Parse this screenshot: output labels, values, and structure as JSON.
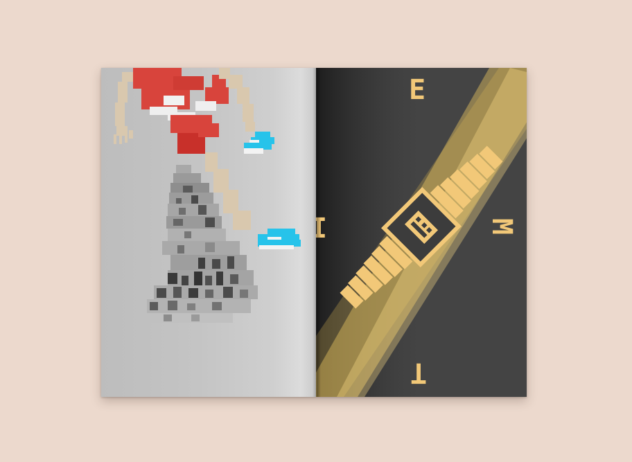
{
  "spread": {
    "left_page": {
      "illustration": "pixel-art-runner-over-rocks"
    },
    "right_page": {
      "illustration": "pixel-art-gold-wristwatch",
      "letters": {
        "top": "E",
        "left": "I",
        "right": "M",
        "bottom": "T"
      }
    }
  },
  "colors": {
    "background": "#ecd9cd",
    "gold": "#f2c878",
    "dark_page": "#444444",
    "shorts_red": "#d8443c",
    "shoe_cyan": "#27c3ea",
    "skin": "#d9c8ae"
  }
}
